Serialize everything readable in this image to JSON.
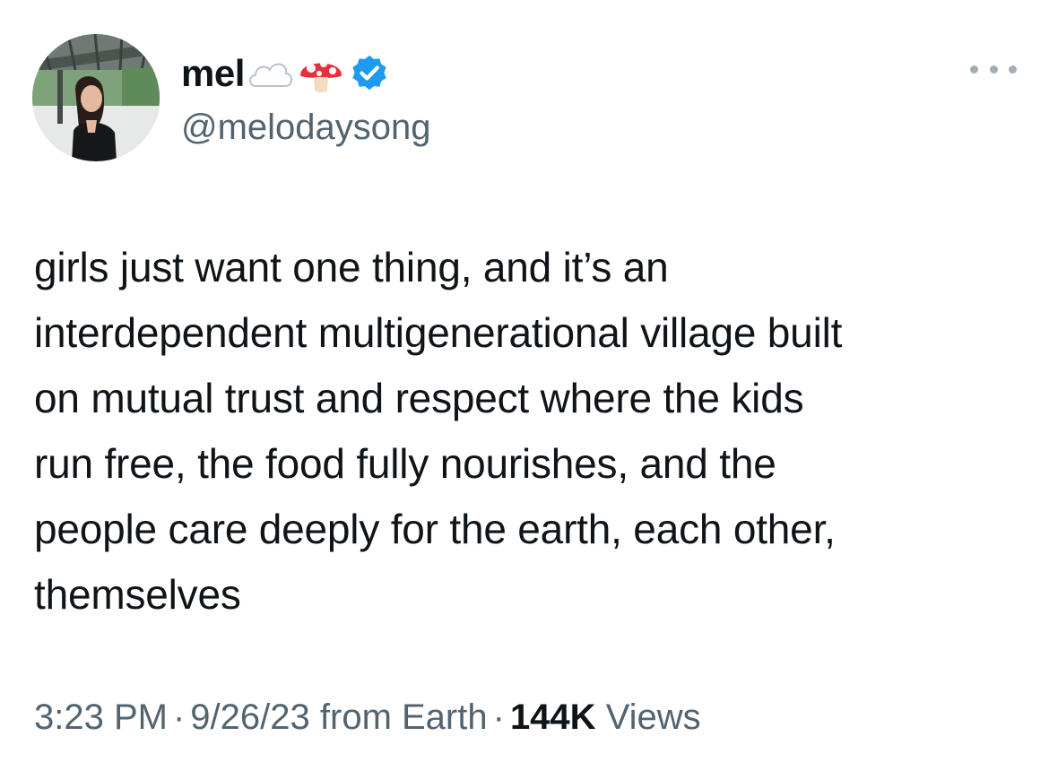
{
  "author": {
    "display_name": "mel",
    "emoji_1": "cloud-emoji",
    "emoji_2": "mushroom-emoji",
    "verified_icon": "verified-badge-icon",
    "handle": "@melodaysong",
    "accent_color": "#1d9bf0"
  },
  "tweet": {
    "text": "girls just want one thing, and it’s an\ninterdependent multigenerational village built\non mutual trust and respect where the kids\nrun free, the food fully nourishes, and the\npeople care deeply for the earth, each other,\nthemselves"
  },
  "meta": {
    "time": "3:23 PM",
    "separator": "·",
    "date": "9/26/23",
    "source": "from Earth",
    "views_count": "144K",
    "views_label": "Views"
  },
  "menu": {
    "icon": "more-options-icon"
  }
}
